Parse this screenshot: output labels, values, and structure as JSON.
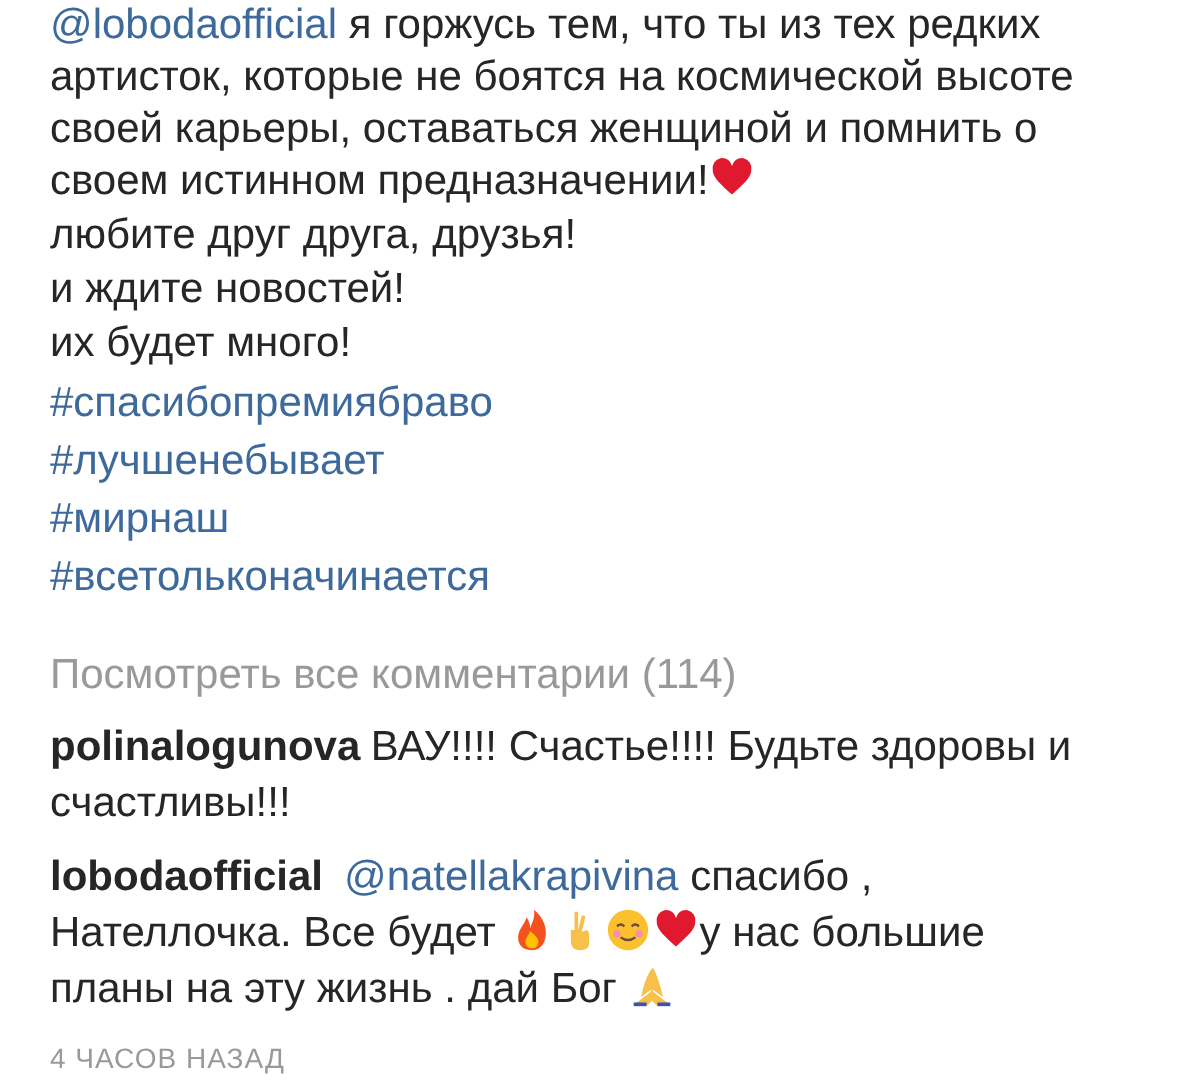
{
  "caption": {
    "segments": [
      {
        "kind": "mention",
        "text": "@lobodaofficial"
      },
      {
        "kind": "text",
        "text": " я горжусь тем, что ты из тех редких артисток, которые не боятся на космической высоте своей карьеры, оставаться женщиной и помнить о своем истинном предназначении!"
      },
      {
        "kind": "heart"
      }
    ],
    "lines": [
      "любите друг друга, друзья!",
      "и ждите новостей!",
      "их будет много!"
    ],
    "hashtags": [
      "#спасибопремиябраво",
      "#лучшенебывает",
      "#мирнаш",
      "#всетольконачинается"
    ]
  },
  "view_all": "Посмотреть все комментарии (114)",
  "comments": [
    {
      "username": "polinalogunova",
      "segments": [
        {
          "kind": "text",
          "text": "ВАУ!!!! Счастье!!!! Будьте здоровы и счастливы!!!"
        }
      ]
    },
    {
      "username": "lobodaofficial",
      "segments": [
        {
          "kind": "mention",
          "text": "@natellakrapivina"
        },
        {
          "kind": "text",
          "text": " спасибо , Нателлочка. Все будет "
        },
        {
          "kind": "flame"
        },
        {
          "kind": "fingers"
        },
        {
          "kind": "smile"
        },
        {
          "kind": "heart"
        },
        {
          "kind": "text",
          "text": "у нас большие планы на эту жизнь . дай Бог "
        },
        {
          "kind": "pray"
        }
      ]
    }
  ],
  "timestamp": "4 ЧАСОВ НАЗАД"
}
